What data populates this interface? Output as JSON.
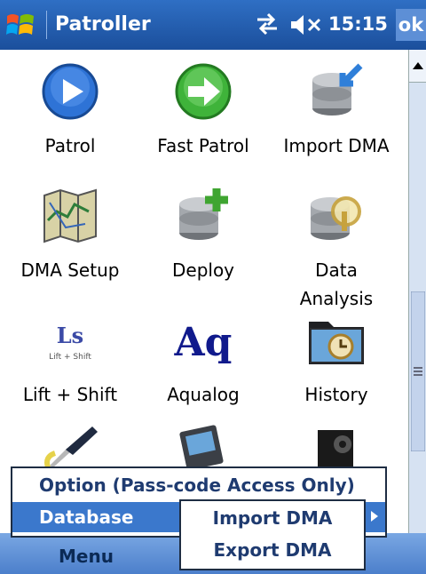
{
  "titlebar": {
    "app_title": "Patroller",
    "time": "15:15",
    "ok_label": "ok"
  },
  "grid": [
    {
      "label": "Patrol",
      "icon": "play-icon"
    },
    {
      "label": "Fast Patrol",
      "icon": "fast-forward-icon"
    },
    {
      "label": "Import DMA",
      "icon": "database-import-icon"
    },
    {
      "label": "DMA Setup",
      "icon": "map-icon"
    },
    {
      "label": "Deploy",
      "icon": "database-add-icon"
    },
    {
      "label": "Data\nAnalysis",
      "icon": "database-search-icon"
    },
    {
      "label": "Lift + Shift",
      "icon": "lift-shift-logo-icon"
    },
    {
      "label": "Aqualog",
      "icon": "aqualog-logo-icon"
    },
    {
      "label": "History",
      "icon": "history-folder-icon"
    }
  ],
  "icon_text": {
    "lift_shift_mark": "Ls",
    "lift_shift_small": "Lift + Shift",
    "aqualog_mark": "Aq"
  },
  "menubar": {
    "menu_label": "Menu"
  },
  "popup_menu": {
    "option_label": "Option (Pass-code Access Only)",
    "database_label": "Database"
  },
  "database_submenu": {
    "import_label": "Import DMA",
    "export_label": "Export DMA"
  },
  "colors": {
    "titlebar": "#1b4f9c",
    "highlight": "#3b78cc",
    "menu_text": "#1f3b70"
  }
}
